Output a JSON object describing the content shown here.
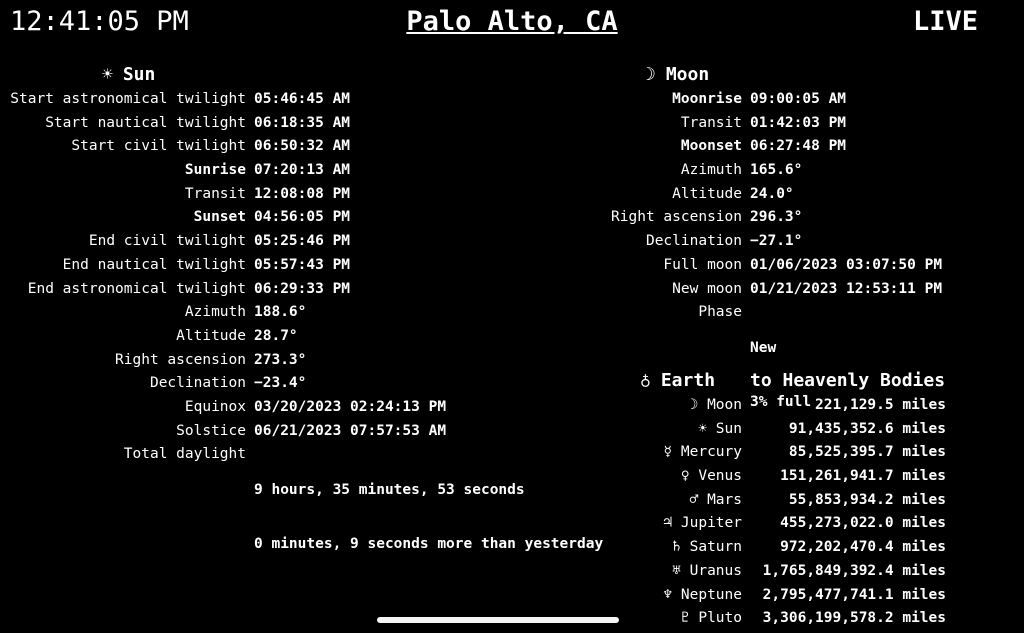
{
  "header": {
    "time": "12:41:05 PM",
    "location": "Palo Alto, CA",
    "status": "LIVE"
  },
  "sun": {
    "symbol": "☀",
    "title": "Sun",
    "rows": [
      {
        "label": "Start astronomical twilight",
        "value": "05:46:45 AM"
      },
      {
        "label": "Start nautical twilight",
        "value": "06:18:35 AM"
      },
      {
        "label": "Start civil twilight",
        "value": "06:50:32 AM"
      },
      {
        "label": "Sunrise",
        "value": "07:20:13 AM"
      },
      {
        "label": "Transit",
        "value": "12:08:08 PM"
      },
      {
        "label": "Sunset",
        "value": "04:56:05 PM"
      },
      {
        "label": "End civil twilight",
        "value": "05:25:46 PM"
      },
      {
        "label": "End nautical twilight",
        "value": "05:57:43 PM"
      },
      {
        "label": "End astronomical twilight",
        "value": "06:29:33 PM"
      },
      {
        "label": "Azimuth",
        "value": "188.6°"
      },
      {
        "label": "Altitude",
        "value": "28.7°"
      },
      {
        "label": "Right ascension",
        "value": "273.3°"
      },
      {
        "label": "Declination",
        "value": "−23.4°"
      },
      {
        "label": "Equinox",
        "value": "03/20/2023 02:24:13 PM"
      },
      {
        "label": "Solstice",
        "value": "06/21/2023 07:57:53 AM"
      }
    ],
    "daylight": {
      "label": "Total daylight",
      "line1": "9 hours, 35 minutes, 53 seconds",
      "line2": "0 minutes, 9 seconds more than yesterday"
    }
  },
  "moon": {
    "symbol": "☽",
    "title": "Moon",
    "rows": [
      {
        "label": "Moonrise",
        "value": "09:00:05 AM"
      },
      {
        "label": "Transit",
        "value": "01:42:03 PM"
      },
      {
        "label": "Moonset",
        "value": "06:27:48 PM"
      },
      {
        "label": "Azimuth",
        "value": "165.6°"
      },
      {
        "label": "Altitude",
        "value": "24.0°"
      },
      {
        "label": "Right ascension",
        "value": "296.3°"
      },
      {
        "label": "Declination",
        "value": "−27.1°"
      },
      {
        "label": "Full moon",
        "value": "01/06/2023 03:07:50 PM"
      },
      {
        "label": "New moon",
        "value": "01/21/2023 12:53:11 PM"
      }
    ],
    "phase": {
      "label": "Phase",
      "line1": "New",
      "line2": "3% full"
    }
  },
  "earth": {
    "symbol": "♁",
    "title": "Earth",
    "subtitle": "to Heavenly Bodies",
    "bodies": [
      {
        "symbol": "☽",
        "name": "Moon",
        "distance": "221,129.5 miles"
      },
      {
        "symbol": "☀",
        "name": "Sun",
        "distance": "91,435,352.6 miles"
      },
      {
        "symbol": "☿",
        "name": "Mercury",
        "distance": "85,525,395.7 miles"
      },
      {
        "symbol": "♀",
        "name": "Venus",
        "distance": "151,261,941.7 miles"
      },
      {
        "symbol": "♂",
        "name": "Mars",
        "distance": "55,853,934.2 miles"
      },
      {
        "symbol": "♃",
        "name": "Jupiter",
        "distance": "455,273,022.0 miles"
      },
      {
        "symbol": "♄",
        "name": "Saturn",
        "distance": "972,202,470.4 miles"
      },
      {
        "symbol": "♅",
        "name": "Uranus",
        "distance": "1,765,849,392.4 miles"
      },
      {
        "symbol": "♆",
        "name": "Neptune",
        "distance": "2,795,477,741.1 miles"
      },
      {
        "symbol": "♇",
        "name": "Pluto",
        "distance": "3,306,199,578.2 miles"
      }
    ]
  }
}
